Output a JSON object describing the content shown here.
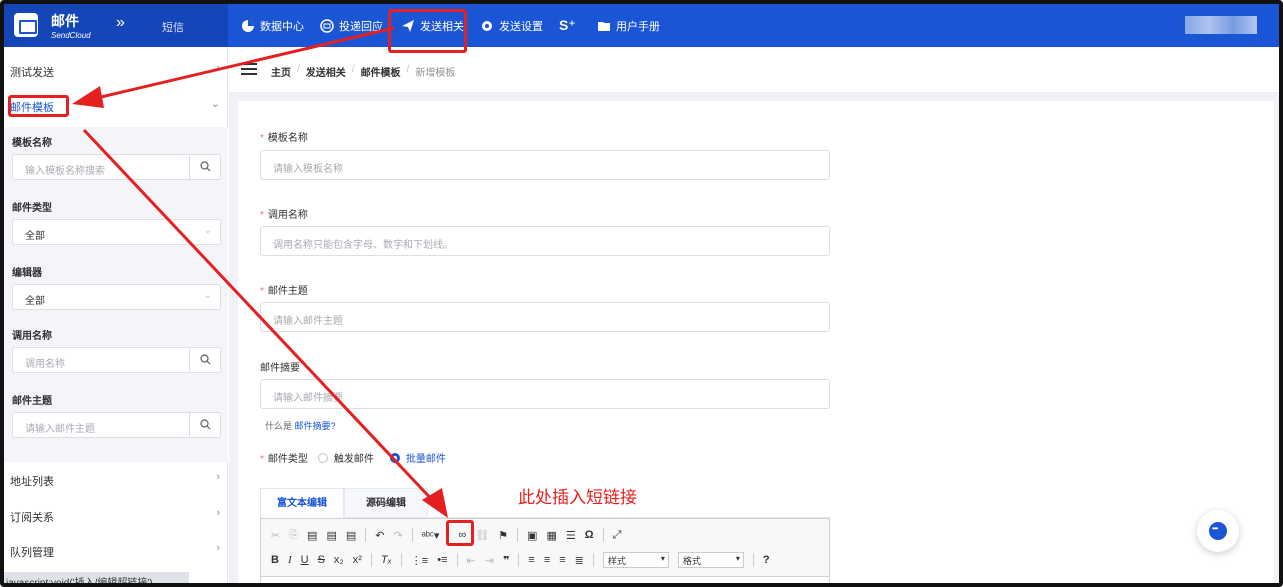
{
  "topbar": {
    "brand_title": "邮件",
    "brand_sub": "SendCloud",
    "collapse_icon": "double-chevron-right-icon",
    "sms_label": "短信",
    "nav": [
      {
        "label": "数据中心",
        "icon": "pie-chart-icon"
      },
      {
        "label": "投递回应",
        "icon": "mail-reply-icon"
      },
      {
        "label": "发送相关",
        "icon": "send-plane-icon"
      },
      {
        "label": "发送设置",
        "icon": "gear-icon"
      },
      {
        "label": "S⁺",
        "icon": "s-plus-icon"
      },
      {
        "label": "用户手册",
        "icon": "folder-icon"
      }
    ]
  },
  "sidebar": {
    "items": [
      {
        "label": "测试发送"
      },
      {
        "label": "邮件模板"
      },
      {
        "label": "地址列表"
      },
      {
        "label": "订阅关系"
      },
      {
        "label": "队列管理"
      }
    ],
    "filters": {
      "template_name": {
        "label": "模板名称",
        "placeholder": "输入模板名称搜索"
      },
      "mail_type": {
        "label": "邮件类型",
        "value": "全部"
      },
      "editor": {
        "label": "编辑器",
        "value": "全部"
      },
      "call_name": {
        "label": "调用名称",
        "placeholder": "调用名称"
      },
      "subject": {
        "label": "邮件主题",
        "placeholder": "请输入邮件主题"
      }
    },
    "status_url": "javascript:void('插入/编辑超链接')"
  },
  "breadcrumb": {
    "home": "主页",
    "sep": "/",
    "level1": "发送相关",
    "level2": "邮件模板",
    "current": "新增模板"
  },
  "form": {
    "required_mark": "*",
    "template_name": {
      "label": "模板名称",
      "placeholder": "请输入模板名称"
    },
    "call_name": {
      "label": "调用名称",
      "placeholder": "调用名称只能包含字母、数字和下划线。"
    },
    "subject": {
      "label": "邮件主题",
      "placeholder": "请输入邮件主题"
    },
    "summary": {
      "label": "邮件摘要",
      "placeholder": "请输入邮件摘要"
    },
    "summary_hint": "什么是",
    "summary_hint_link": "邮件摘要?",
    "mail_type": {
      "label": "邮件类型",
      "options": [
        "触发邮件",
        "批量邮件"
      ],
      "selected": "批量邮件"
    }
  },
  "editor": {
    "tabs": [
      "富文本编辑",
      "源码编辑"
    ],
    "active_tab": "富文本编辑",
    "toolbar_row1": [
      "✂",
      "⎘",
      "📋",
      "📋",
      "📋",
      "↶",
      "↷",
      "abc",
      "🔗",
      "⛓",
      "⚑",
      "🖼",
      "▦",
      "≡",
      "Ω",
      "⛶"
    ],
    "toolbar_row2": [
      "B",
      "I",
      "U",
      "S",
      "x₂",
      "x²",
      "Tx",
      "⋮≡",
      "•≡",
      "⇤",
      "⇥",
      "99",
      "≡",
      "≡",
      "≡",
      "≡"
    ],
    "style_combo": "样式",
    "format_combo": "格式",
    "help": "?"
  },
  "annotation": {
    "text": "此处插入短链接",
    "color": "#e52020"
  },
  "colors": {
    "primary": "#1a55d6",
    "brand_dark": "#1546b8",
    "danger": "#f56c6c"
  }
}
